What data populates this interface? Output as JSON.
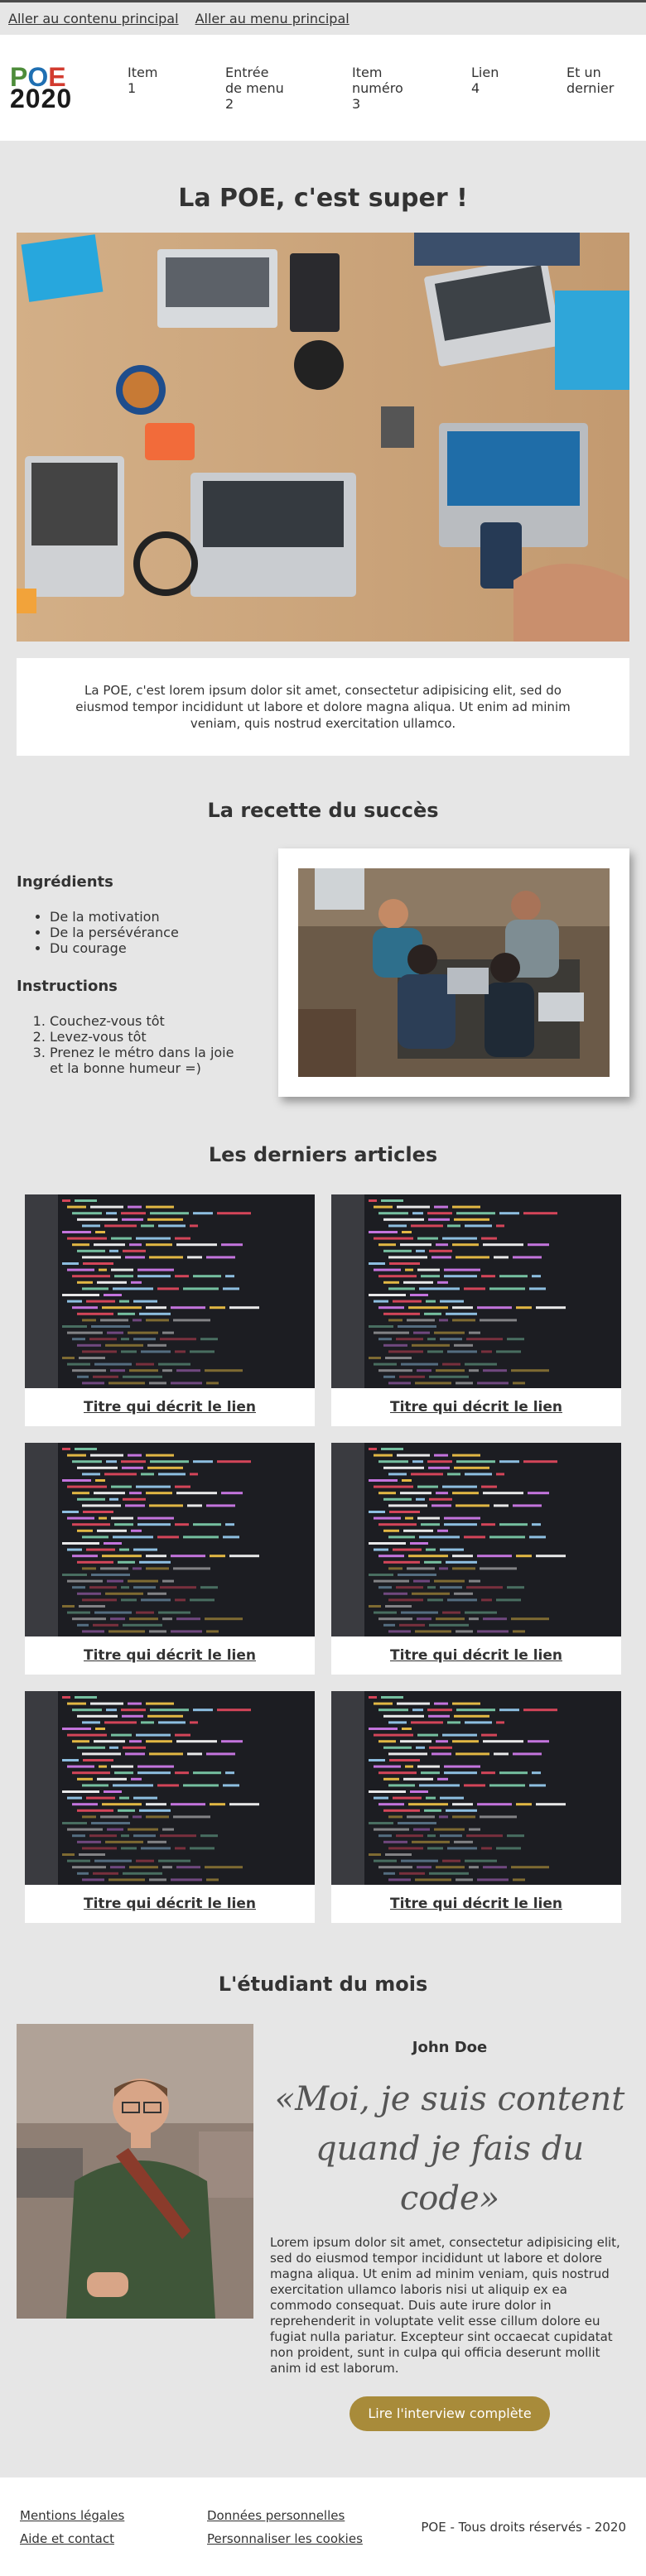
{
  "skip_links": [
    "Aller au contenu principal",
    "Aller au menu principal"
  ],
  "logo": {
    "line1": [
      "P",
      "O",
      "E"
    ],
    "line2": "2020"
  },
  "nav": [
    {
      "lines": [
        "Item",
        "1"
      ]
    },
    {
      "lines": [
        "Entrée",
        "de menu",
        "2"
      ]
    },
    {
      "lines": [
        "Item",
        "numéro",
        "3"
      ]
    },
    {
      "lines": [
        "Lien",
        "4"
      ]
    },
    {
      "lines": [
        "Et un",
        "dernier"
      ]
    }
  ],
  "hero": {
    "title": "La POE, c'est super !",
    "intro": "La POE, c'est lorem ipsum dolor sit amet, consectetur adipisicing elit, sed do eiusmod tempor incididunt ut labore et dolore magna aliqua. Ut enim ad minim veniam, quis nostrud exercitation ullamco."
  },
  "recipe": {
    "title": "La recette du succès",
    "ingredients_heading": "Ingrédients",
    "ingredients": [
      "De la motivation",
      "De la persévérance",
      "Du courage"
    ],
    "instructions_heading": "Instructions",
    "instructions": [
      "Couchez-vous tôt",
      "Levez-vous tôt",
      "Prenez le métro dans la joie et la bonne humeur =)"
    ]
  },
  "articles": {
    "title": "Les derniers articles",
    "items": [
      {
        "link": "Titre qui décrit le lien"
      },
      {
        "link": "Titre qui décrit le lien"
      },
      {
        "link": "Titre qui décrit le lien"
      },
      {
        "link": "Titre qui décrit le lien"
      },
      {
        "link": "Titre qui décrit le lien"
      },
      {
        "link": "Titre qui décrit le lien"
      }
    ]
  },
  "student": {
    "title": "L'étudiant du mois",
    "name": "John Doe",
    "quote": "«Moi, je suis content quand je fais du code»",
    "text": "Lorem ipsum dolor sit amet, consectetur adipisicing elit, sed do eiusmod tempor incididunt ut labore et dolore magna aliqua. Ut enim ad minim veniam, quis nostrud exercitation ullamco laboris nisi ut aliquip ex ea commodo consequat. Duis aute irure dolor in reprehenderit in voluptate velit esse cillum dolore eu fugiat nulla pariatur. Excepteur sint occaecat cupidatat non proident, sunt in culpa qui officia deserunt mollit anim id est laborum.",
    "cta": "Lire l'interview complète"
  },
  "footer": {
    "legal": "Mentions légales",
    "contact": "Aide et contact",
    "data": "Données personnelles",
    "cookies": "Personnaliser les cookies",
    "copyright": "POE - Tous droits réservés - 2020"
  },
  "colors": {
    "background": "#e6e6e6",
    "cta": "#a88b3a",
    "logo_green": "#4d8c3a",
    "logo_blue": "#1f6fb2",
    "logo_red": "#d23b2f"
  }
}
